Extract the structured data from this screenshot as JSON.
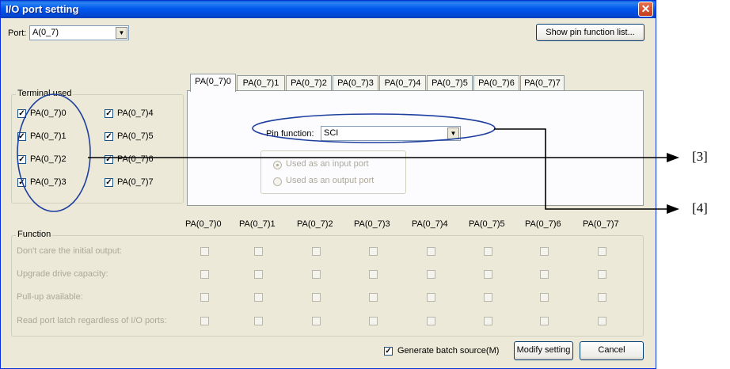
{
  "window": {
    "title": "I/O port setting",
    "close_glyph": "✕"
  },
  "port": {
    "label": "Port:",
    "value": "A(0_7)"
  },
  "show_pin_button": "Show pin function list...",
  "terminal_used": {
    "title": "Terminal used",
    "items": [
      {
        "label": "PA(0_7)0",
        "checked": true
      },
      {
        "label": "PA(0_7)1",
        "checked": true
      },
      {
        "label": "PA(0_7)2",
        "checked": true
      },
      {
        "label": "PA(0_7)3",
        "checked": true
      },
      {
        "label": "PA(0_7)4",
        "checked": true
      },
      {
        "label": "PA(0_7)5",
        "checked": true
      },
      {
        "label": "PA(0_7)6",
        "checked": true
      },
      {
        "label": "PA(0_7)7",
        "checked": true
      }
    ]
  },
  "tabs": [
    "PA(0_7)0",
    "PA(0_7)1",
    "PA(0_7)2",
    "PA(0_7)3",
    "PA(0_7)4",
    "PA(0_7)5",
    "PA(0_7)6",
    "PA(0_7)7"
  ],
  "active_tab": "PA(0_7)0",
  "pin_function": {
    "label": "Pin function:",
    "value": "SCI"
  },
  "direction": {
    "input_label": "Used as an input port",
    "output_label": "Used as an output port",
    "selected": "input"
  },
  "function": {
    "title": "Function",
    "columns": [
      "PA(0_7)0",
      "PA(0_7)1",
      "PA(0_7)2",
      "PA(0_7)3",
      "PA(0_7)4",
      "PA(0_7)5",
      "PA(0_7)6",
      "PA(0_7)7"
    ],
    "rows": [
      "Don't care the initial output:",
      "Upgrade drive capacity:",
      "Pull-up available:",
      "Read port latch regardless of I/O ports:"
    ]
  },
  "generate_batch": {
    "label": "Generate batch source(M)",
    "checked": true
  },
  "modify_button": "Modify setting",
  "cancel_button": "Cancel",
  "annotations": [
    "[3]",
    "[4]"
  ],
  "colors": {
    "titlebar": "#0054e3",
    "face": "#ece9d8",
    "annotation_ellipse": "#1f3f9f"
  },
  "icons": [
    "close-icon",
    "dropdown-arrow-icon",
    "checkbox-check-icon",
    "radio-dot-icon",
    "arrow-right-icon"
  ]
}
